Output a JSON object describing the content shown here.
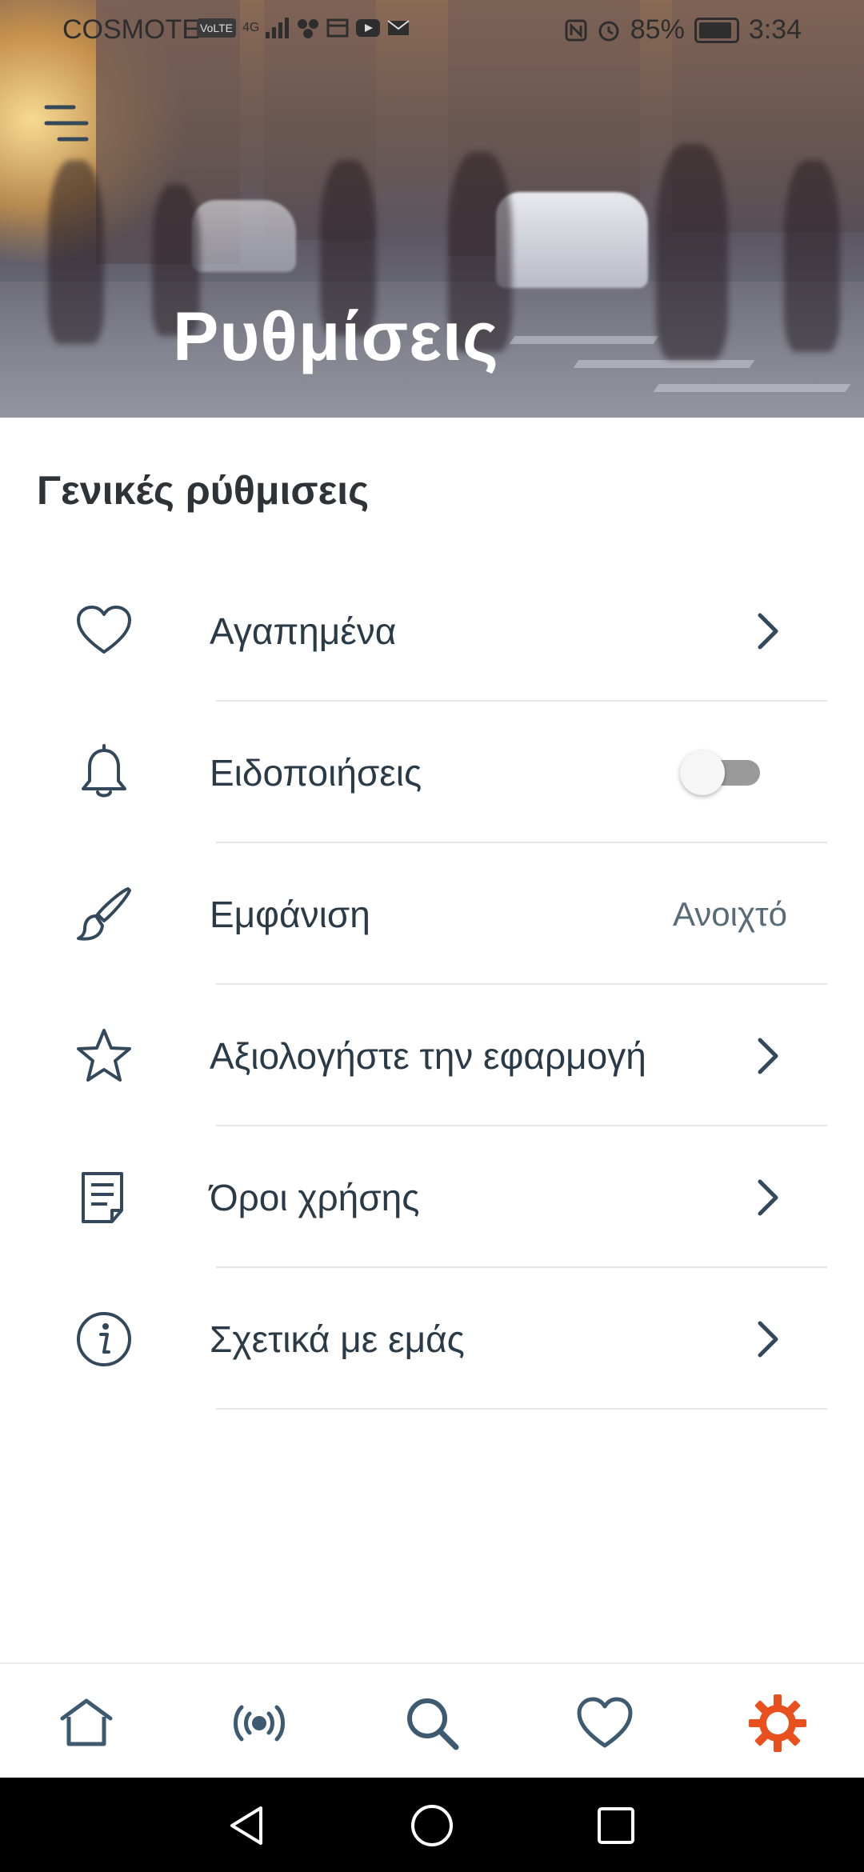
{
  "status_bar": {
    "carrier": "COSMOTE",
    "volte": "VoLTE",
    "network": "4G",
    "battery": "85%",
    "time": "3:34"
  },
  "header": {
    "title": "Ρυθμίσεις"
  },
  "section": {
    "title": "Γενικές ρύθμισεις"
  },
  "settings": [
    {
      "label": "Αγαπημένα",
      "icon": "heart-icon",
      "control": "chevron"
    },
    {
      "label": "Ειδοποιήσεις",
      "icon": "bell-icon",
      "control": "toggle",
      "enabled": false
    },
    {
      "label": "Εμφάνιση",
      "icon": "brush-icon",
      "control": "value",
      "value": "Ανοιχτό"
    },
    {
      "label": "Αξιολογήστε την εφαρμογή",
      "icon": "star-icon",
      "control": "chevron"
    },
    {
      "label": "Όροι χρήσης",
      "icon": "document-icon",
      "control": "chevron"
    },
    {
      "label": "Σχετικά με εμάς",
      "icon": "info-icon",
      "control": "chevron"
    }
  ],
  "bottom_nav": {
    "items": [
      "home-icon",
      "radio-icon",
      "search-icon",
      "heart-icon",
      "gear-icon"
    ],
    "active": "gear-icon"
  },
  "colors": {
    "accent": "#e8501e",
    "icon": "#33485a",
    "text": "#2b3a47",
    "nav_icon": "#3e5a70"
  }
}
